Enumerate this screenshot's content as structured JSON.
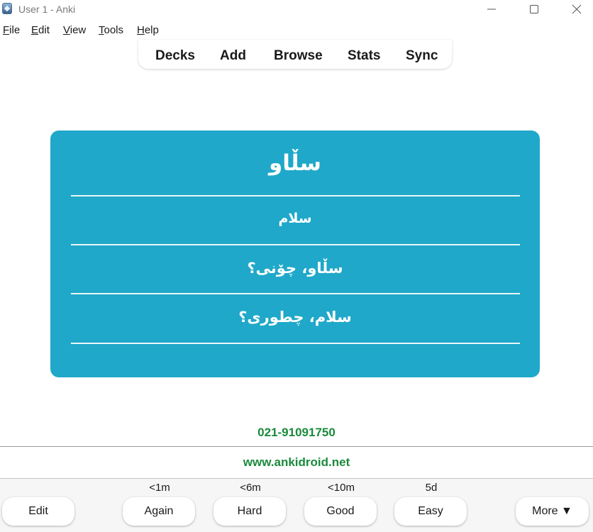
{
  "window": {
    "title": "User 1 - Anki"
  },
  "menu": [
    {
      "key": "F",
      "rest": "ile"
    },
    {
      "key": "E",
      "rest": "dit"
    },
    {
      "key": "V",
      "rest": "iew"
    },
    {
      "key": "T",
      "rest": "ools"
    },
    {
      "key": "H",
      "rest": "elp"
    }
  ],
  "toolbar": {
    "decks": "Decks",
    "add": "Add",
    "browse": "Browse",
    "stats": "Stats",
    "sync": "Sync"
  },
  "card": {
    "title": "سڵاو",
    "line1": "سلام",
    "line2": "سڵاو، چۆنی؟",
    "line3": "سلام، چطوری؟"
  },
  "contact": {
    "phone": "021-91091750",
    "url": "www.ankidroid.net"
  },
  "bottom": {
    "edit": "Edit",
    "again": "Again",
    "again_interval": "<1m",
    "hard": "Hard",
    "hard_interval": "<6m",
    "good": "Good",
    "good_interval": "<10m",
    "easy": "Easy",
    "easy_interval": "5d",
    "more": "More ▼"
  },
  "colors": {
    "card_bg": "#1fa8c9",
    "contact_text": "#1a8a3c"
  }
}
